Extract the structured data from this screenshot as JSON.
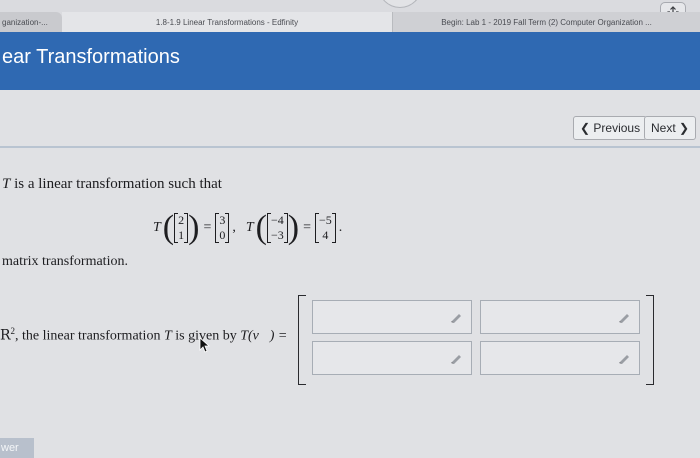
{
  "browser": {
    "tabs": [
      {
        "label": "ganization-..."
      },
      {
        "label": "1.8-1.9 Linear Transformations - Edfinity"
      },
      {
        "label": "Begin: Lab 1 - 2019 Fall Term (2) Computer Organization ..."
      }
    ]
  },
  "header": {
    "title": "ear Transformations"
  },
  "nav": {
    "previous": "Previous",
    "next": "Next"
  },
  "problem": {
    "intro_T": "T",
    "intro_rest": " is a linear transformation such that",
    "eq1": {
      "fn": "T",
      "input": [
        "2",
        "1"
      ],
      "output": [
        "3",
        "0"
      ]
    },
    "eq2": {
      "fn": "T",
      "input": [
        "−4",
        "−3"
      ],
      "output": [
        "−5",
        "4"
      ]
    },
    "eq_sign": "=",
    "separator": ",",
    "end_punct": ".",
    "line2": "matrix transformation.",
    "line3_space": "R",
    "line3_sup": "2",
    "line3_text": ", the linear transformation ",
    "line3_T": "T",
    "line3_text2": " is given by ",
    "line3_Tv": "T(v⃗) ="
  },
  "answer_matrix": {
    "cells": [
      "",
      "",
      "",
      ""
    ]
  },
  "answer_button": "wer",
  "colors": {
    "header_blue": "#2f69b2",
    "content_bg": "#e0e1e4"
  },
  "icons": [
    "share-icon",
    "chevron-left-icon",
    "chevron-right-icon",
    "pencil-icon",
    "cursor-icon"
  ]
}
